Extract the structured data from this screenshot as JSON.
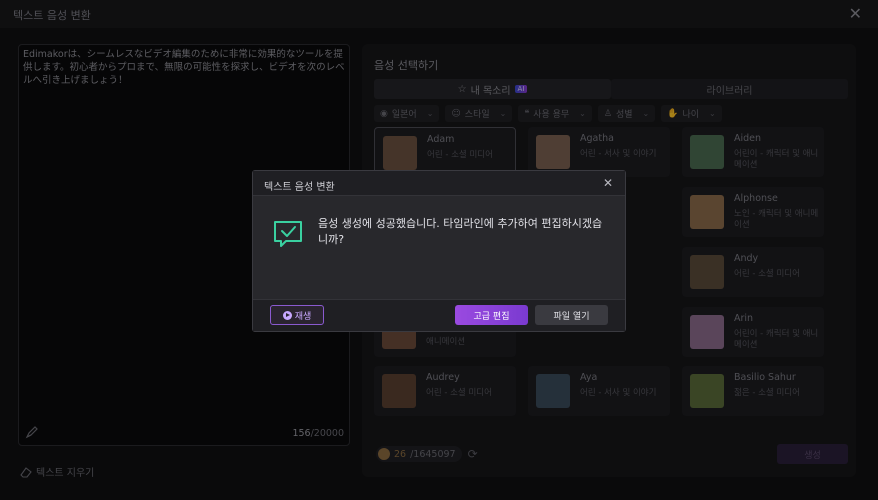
{
  "window": {
    "title": "텍스트 음성 변환"
  },
  "editor": {
    "text": "Edimakorは、シームレスなビデオ編集のために非常に効果的なツールを提供します。初心者からプロまで、無限の可能性を探求し、ビデオを次のレベルへ引き上げましょう！",
    "char_count": "156",
    "char_limit": "/20000",
    "clear_label": "텍스트 지우기"
  },
  "voice_panel": {
    "heading": "음성 선택하기",
    "tabs": [
      {
        "label": "내 목소리",
        "badge": "AI"
      },
      {
        "label": "라이브러리"
      }
    ],
    "filters": [
      {
        "label": "일본어"
      },
      {
        "label": "스타일"
      },
      {
        "label": "사용 용무"
      },
      {
        "label": "성별"
      },
      {
        "label": "나이"
      }
    ],
    "voices": [
      {
        "name": "Adam",
        "desc": "어린 - 소셜 미디어",
        "color": "#6a5040"
      },
      {
        "name": "Agatha",
        "desc": "어린 - 서사 및 이야기",
        "color": "#7a6050"
      },
      {
        "name": "Aiden",
        "desc": "어린이 - 캐릭터 및 애니메이션",
        "color": "#4a6a50"
      },
      {
        "name": "Alphonse",
        "desc": "노인 - 캐릭터 및 애니메이션",
        "color": "#8a6a4a"
      },
      {
        "name": "Andy",
        "desc": "어린 - 소셜 미디어",
        "color": "#5a4a3a"
      },
      {
        "name": "Arin",
        "desc": "어린이 - 캐릭터 및 애니메이션",
        "color": "#8a6a8a"
      },
      {
        "name": "애니메이션",
        "desc": "",
        "color": "#6a4a3a"
      },
      {
        "name": "Audrey",
        "desc": "어린 - 소셜 미디어",
        "color": "#5a4030"
      },
      {
        "name": "Aya",
        "desc": "어린 - 서사 및 이야기",
        "color": "#3a4a5a"
      },
      {
        "name": "Basilio Sahur",
        "desc": "젊은 - 소셜 미디어",
        "color": "#5a6a3a"
      }
    ],
    "credits_used": "26",
    "credits_total": "/1645097",
    "generate_label": "생성"
  },
  "dialog": {
    "title": "텍스트 음성 변환",
    "message": "음성 생성에 성공했습니다. 타임라인에 추가하여 편집하시겠습니까?",
    "play_label": "재생",
    "edit_label": "고급 편집",
    "open_label": "파일 열기"
  }
}
